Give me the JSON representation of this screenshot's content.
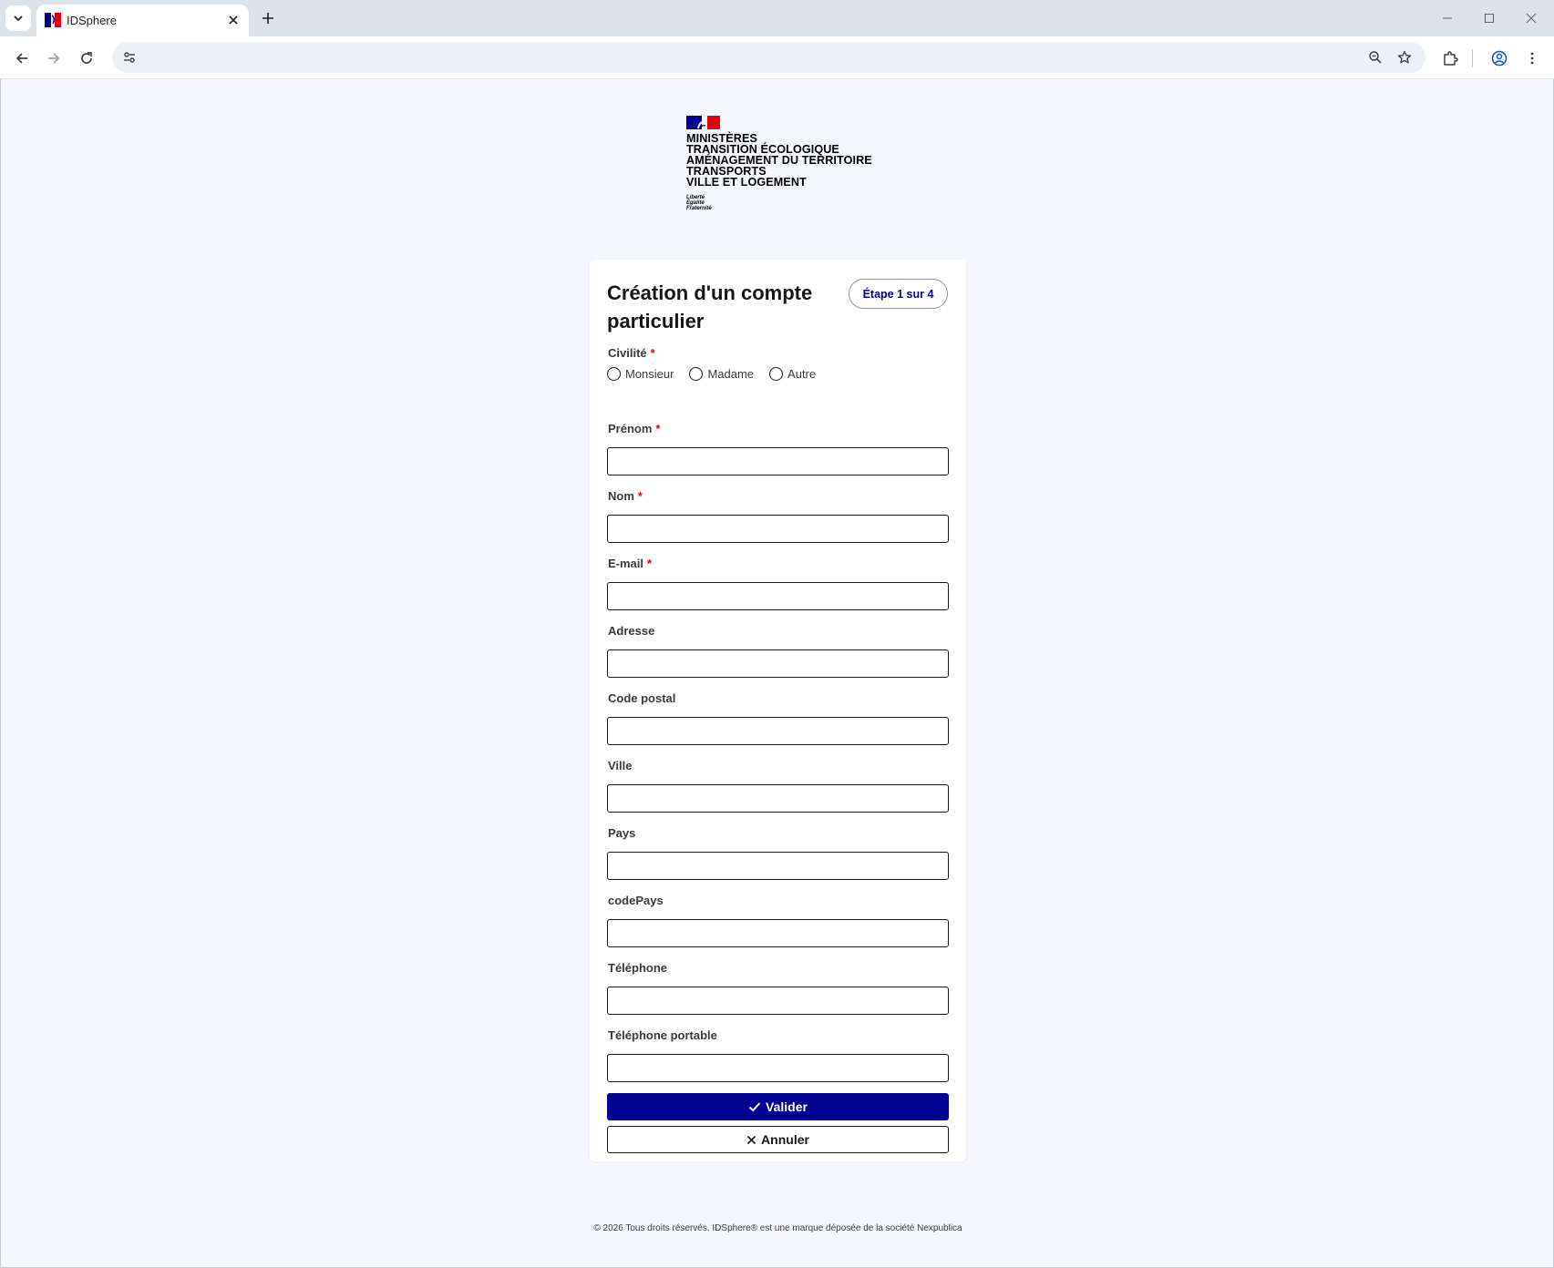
{
  "browser": {
    "tab_title": "IDSphere",
    "url": ""
  },
  "logo": {
    "lines": [
      "MINISTÈRES",
      "TRANSITION ÉCOLOGIQUE",
      "AMÉNAGEMENT DU TERRITOIRE",
      "TRANSPORTS",
      "VILLE ET LOGEMENT"
    ],
    "motto": [
      "Liberté",
      "Égalité",
      "Fraternité"
    ],
    "colors": {
      "blue": "#000091",
      "red": "#e1000f"
    }
  },
  "form": {
    "title": "Création d'un compte particulier",
    "step": "Étape 1 sur 4",
    "civility": {
      "label": "Civilité",
      "required_mark": "*",
      "options": [
        "Monsieur",
        "Madame",
        "Autre"
      ]
    },
    "fields": [
      {
        "label": "Prénom",
        "required": "*",
        "value": ""
      },
      {
        "label": "Nom",
        "required": "*",
        "value": ""
      },
      {
        "label": "E-mail",
        "required": "*",
        "value": ""
      },
      {
        "label": "Adresse",
        "value": ""
      },
      {
        "label": "Code postal",
        "value": ""
      },
      {
        "label": "Ville",
        "value": ""
      },
      {
        "label": "Pays",
        "value": ""
      },
      {
        "label": "codePays",
        "value": ""
      },
      {
        "label": "Téléphone",
        "value": ""
      },
      {
        "label": "Téléphone portable",
        "value": ""
      }
    ],
    "submit_label": "Valider",
    "cancel_label": "Annuler"
  },
  "footer": {
    "text": "© 2026 Tous droits réservés. IDSphere® est une marque déposée de la société Nexpublica"
  },
  "theme": {
    "primary": "#000091",
    "page_bg": "#f5f7fc"
  }
}
